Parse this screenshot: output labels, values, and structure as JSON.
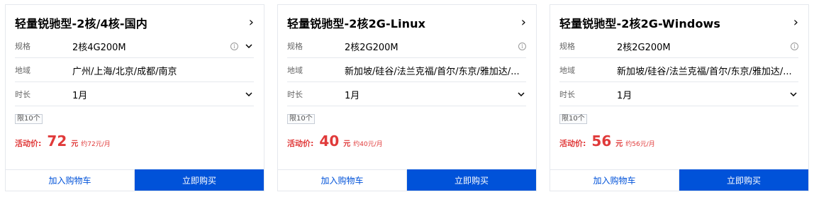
{
  "labels": {
    "spec": "规格",
    "region": "地域",
    "duration": "时长",
    "price": "活动价:",
    "currency": "元",
    "cart": "加入购物车",
    "buy": "立即购买"
  },
  "icons": {
    "arrow": "chevron-right-icon",
    "info": "info-icon",
    "dropdown": "chevron-down-icon"
  },
  "colors": {
    "accent": "#0052d9",
    "price": "#e03a3a",
    "border": "#e5e8ed"
  },
  "cards": [
    {
      "title": "轻量锐驰型-2核/4核-国内",
      "spec": "2核4G200M",
      "region": "广州/上海/北京/成都/南京",
      "duration": "1月",
      "limit": "限10个",
      "price": "72",
      "per_month": "约72元/月"
    },
    {
      "title": "轻量锐驰型-2核2G-Linux",
      "spec": "2核2G200M",
      "region": "新加坡/硅谷/法兰克福/首尔/东京/雅加达/...",
      "duration": "1月",
      "limit": "限10个",
      "price": "40",
      "per_month": "约40元/月"
    },
    {
      "title": "轻量锐驰型-2核2G-Windows",
      "spec": "2核2G200M",
      "region": "新加坡/硅谷/法兰克福/首尔/东京/雅加达/...",
      "duration": "1月",
      "limit": "限10个",
      "price": "56",
      "per_month": "约56元/月"
    }
  ]
}
